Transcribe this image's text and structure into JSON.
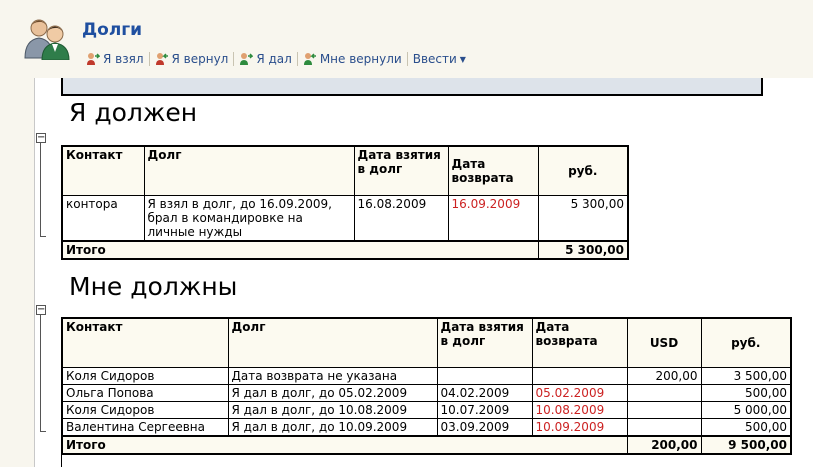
{
  "window": {
    "title": "Долги"
  },
  "toolbar": {
    "items": [
      {
        "label": "Я взял"
      },
      {
        "label": "Я вернул"
      },
      {
        "label": "Я дал"
      },
      {
        "label": "Мне вернули"
      },
      {
        "label": "Ввести"
      }
    ]
  },
  "section1": {
    "title": "Я должен",
    "headers": {
      "contact": "Контакт",
      "debt": "Долг",
      "date_taken": "Дата взятия в долг",
      "date_return": "Дата возврата",
      "rub": "руб."
    },
    "rows": [
      {
        "contact": "контора",
        "debt": "Я взял в долг, до 16.09.2009, брал в командировке на личные нужды",
        "date_taken": "16.08.2009",
        "date_return": "16.09.2009",
        "rub": "5 300,00"
      }
    ],
    "total": {
      "label": "Итого",
      "rub": "5 300,00"
    }
  },
  "section2": {
    "title": "Мне должны",
    "headers": {
      "contact": "Контакт",
      "debt": "Долг",
      "date_given": "Дата взятия в долг",
      "date_return": "Дата возврата",
      "usd": "USD",
      "rub": "руб."
    },
    "rows": [
      {
        "contact": "Коля Сидоров",
        "debt": "Дата возврата не указана",
        "date_given": "",
        "date_return": "",
        "usd": "200,00",
        "rub": "3 500,00"
      },
      {
        "contact": "Ольга Попова",
        "debt": "Я дал в долг, до 05.02.2009",
        "date_given": "04.02.2009",
        "date_return": "05.02.2009",
        "usd": "",
        "rub": "500,00"
      },
      {
        "contact": "Коля Сидоров",
        "debt": "Я дал в долг, до 10.08.2009",
        "date_given": "10.07.2009",
        "date_return": "10.08.2009",
        "usd": "",
        "rub": "5 000,00"
      },
      {
        "contact": "Валентина Сергеевна",
        "debt": "Я дал в долг, до 10.09.2009",
        "date_given": "03.09.2009",
        "date_return": "10.09.2009",
        "usd": "",
        "rub": "500,00"
      }
    ],
    "total": {
      "label": "Итого",
      "usd": "200,00",
      "rub": "9 500,00"
    }
  },
  "colors": {
    "title": "#1f4fa0",
    "overdue": "#cc2222",
    "header_bg": "#fcfaf0",
    "window_bg": "#f8f6ee"
  }
}
